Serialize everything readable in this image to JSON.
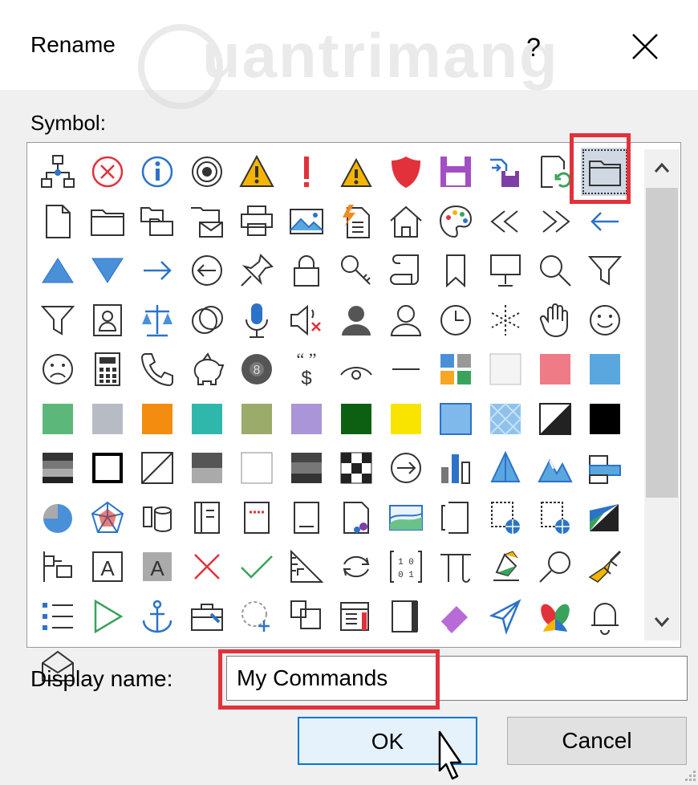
{
  "dialog": {
    "title": "Rename",
    "help_label": "?",
    "close_icon": "close-icon"
  },
  "watermark": {
    "text": "uantrimang",
    "icon": "lightbulb-icon"
  },
  "symbol": {
    "label": "Symbol:",
    "selected_index": 11,
    "icons": [
      "org-chart",
      "error-circle",
      "info-circle",
      "target",
      "warning",
      "exclamation",
      "warning-small",
      "shield",
      "save-purple",
      "save-transfer",
      "save-refresh",
      "folder-window",
      "document",
      "folder",
      "folder-copy",
      "folder-mail",
      "printer",
      "picture",
      "document-lightning",
      "home",
      "palette",
      "double-arrow-left",
      "double-arrow-right",
      "arrow-left",
      "triangle-up",
      "triangle-down",
      "arrow-right",
      "circle-arrow-left",
      "pin",
      "lock",
      "key",
      "scroll",
      "bookmark",
      "presentation",
      "search",
      "filter",
      "filter-2",
      "contact-card",
      "scales",
      "no-entry",
      "microphone",
      "volume-mute",
      "user-filled",
      "user",
      "clock",
      "snowflake",
      "hand",
      "smile",
      "frown",
      "calculator",
      "phone",
      "piggy-bank",
      "ball-8",
      "quote-dollar",
      "eye",
      "dash",
      "grid-color",
      "square-white",
      "square-pink",
      "square-blue",
      "square-green",
      "square-gray",
      "square-orange",
      "square-teal",
      "square-olive",
      "square-lavender",
      "square-dark-green",
      "square-yellow",
      "square-light-blue",
      "square-pattern",
      "square-half",
      "square-black",
      "gradient-gray",
      "square-border-black",
      "square-diagonal",
      "gradient-gray-2",
      "square-white-2",
      "gradient-dark",
      "checkerboard",
      "circle-arrow-right",
      "bar-chart",
      "prism",
      "mountains",
      "stack-boxes",
      "pie-chart",
      "radar",
      "database",
      "notebook",
      "book",
      "document-lines",
      "document-user",
      "landscape",
      "bracket-document",
      "document-globe",
      "document-globe-2",
      "diagonal-banner",
      "flow",
      "text-box",
      "text-box-gray",
      "x-red",
      "checkmark",
      "ruler",
      "refresh",
      "binary",
      "pi",
      "bucket",
      "magnifier",
      "paintbrush",
      "list-bullets",
      "play-triangle",
      "anchor",
      "toolbox",
      "dashed-circle-add",
      "copy-doc",
      "calendar-doc",
      "notebook-2",
      "eraser",
      "paper-plane",
      "butterfly",
      "bell",
      "envelope-open"
    ]
  },
  "scrollbar": {
    "up_icon": "chevron-up-icon",
    "down_icon": "chevron-down-icon"
  },
  "display_name": {
    "label": "Display name:",
    "value": "My Commands"
  },
  "buttons": {
    "ok": "OK",
    "cancel": "Cancel"
  },
  "colors": {
    "highlight": "#e2313b",
    "accent": "#0078d7"
  }
}
